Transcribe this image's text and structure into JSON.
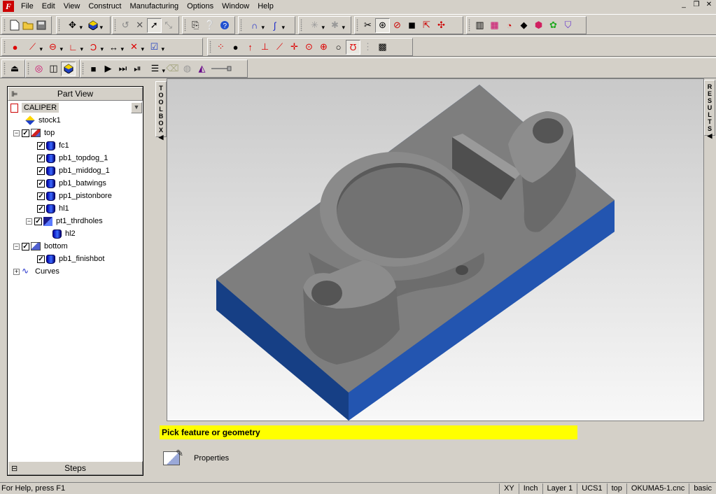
{
  "app": {
    "icon_letter": "F"
  },
  "menu": [
    "File",
    "Edit",
    "View",
    "Construct",
    "Manufacturing",
    "Options",
    "Window",
    "Help"
  ],
  "window_controls": {
    "minimize": "_",
    "restore": "❐",
    "close": "✕"
  },
  "left_panel": {
    "header": "Part View",
    "part_name": "CALIPER",
    "tree": {
      "stock": "stock1",
      "top_setup": "top",
      "top_features": [
        "fc1",
        "pb1_topdog_1",
        "pb1_middog_1",
        "pb1_batwings",
        "pp1_pistonbore",
        "hl1"
      ],
      "pattern": "pt1_thrdholes",
      "pattern_child": "hl2",
      "bottom_setup": "bottom",
      "bottom_features": [
        "pb1_finishbot"
      ],
      "curves": "Curves"
    },
    "footer": "Steps"
  },
  "side_tabs": {
    "toolbox": "TOOLBOX",
    "results": "RESULTS"
  },
  "prompt": "Pick feature or geometry",
  "properties": "Properties",
  "status_bar": {
    "help": "For Help, press F1",
    "plane": "XY",
    "units": "Inch",
    "layer": "Layer 1",
    "ucs": "UCS1",
    "setup": "top",
    "post": "OKUMA5-1.cnc",
    "mode": "basic"
  },
  "colors": {
    "part_gray": "#7a7a7a",
    "stock_blue": "#1f4fa3",
    "prompt_yellow": "#ffff00"
  }
}
